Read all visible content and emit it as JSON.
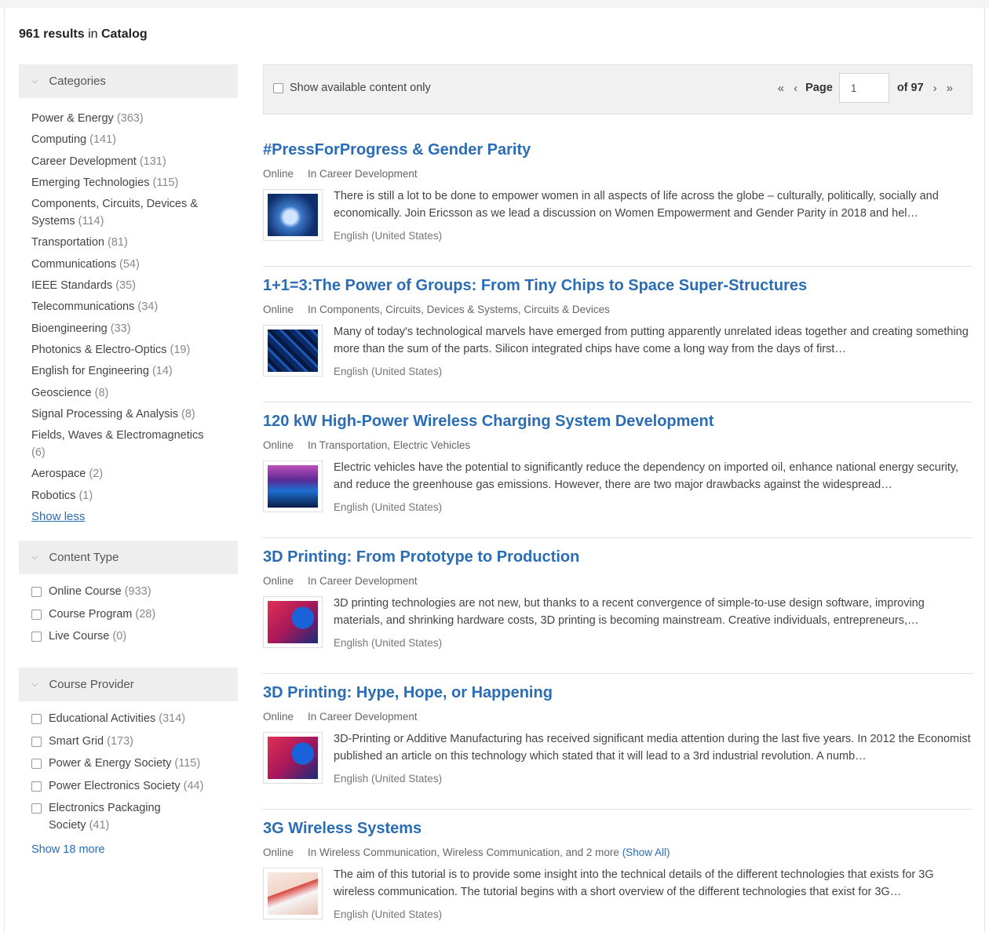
{
  "results_header": {
    "count": "961 results",
    "in_text": "in",
    "scope": "Catalog"
  },
  "facets": {
    "categories": {
      "label": "Categories",
      "items": [
        {
          "name": "Power & Energy",
          "count": "(363)"
        },
        {
          "name": "Computing",
          "count": "(141)"
        },
        {
          "name": "Career Development",
          "count": "(131)"
        },
        {
          "name": "Emerging Technologies",
          "count": "(115)"
        },
        {
          "name": "Components, Circuits, Devices & Systems",
          "count": "(114)"
        },
        {
          "name": "Transportation",
          "count": "(81)"
        },
        {
          "name": "Communications",
          "count": "(54)"
        },
        {
          "name": "IEEE Standards",
          "count": "(35)"
        },
        {
          "name": "Telecommunications",
          "count": "(34)"
        },
        {
          "name": "Bioengineering",
          "count": "(33)"
        },
        {
          "name": "Photonics & Electro-Optics",
          "count": "(19)"
        },
        {
          "name": "English for Engineering",
          "count": "(14)"
        },
        {
          "name": "Geoscience",
          "count": "(8)"
        },
        {
          "name": "Signal Processing & Analysis",
          "count": "(8)"
        },
        {
          "name": "Fields, Waves & Electromagnetics",
          "count": "(6)"
        },
        {
          "name": "Aerospace",
          "count": "(2)"
        },
        {
          "name": "Robotics",
          "count": "(1)"
        }
      ],
      "toggle_label": "Show less"
    },
    "content_type": {
      "label": "Content Type",
      "items": [
        {
          "name": "Online Course",
          "count": "(933)"
        },
        {
          "name": "Course Program",
          "count": "(28)"
        },
        {
          "name": "Live Course",
          "count": "(0)"
        }
      ]
    },
    "course_provider": {
      "label": "Course Provider",
      "items": [
        {
          "name": "Educational Activities",
          "count": "(314)"
        },
        {
          "name": "Smart Grid",
          "count": "(173)"
        },
        {
          "name": "Power & Energy Society",
          "count": "(115)"
        },
        {
          "name": "Power Electronics Society",
          "count": "(44)"
        },
        {
          "name": "Electronics Packaging Society",
          "count": "(41)"
        }
      ],
      "more_label": "Show 18 more"
    }
  },
  "toolbar": {
    "available_only_label": "Show available content only",
    "page_label": "Page",
    "page_value": "1",
    "of_label": "of 97",
    "first_icon": "«",
    "prev_icon": "‹",
    "next_icon": "›",
    "last_icon": "»"
  },
  "results": [
    {
      "title": "#PressForProgress & Gender Parity",
      "format": "Online",
      "category": "In Career Development",
      "description": "There is still a lot to be done to empower women in all aspects of life across the globe – culturally, politically, socially and economically. Join Ericsson as we lead a discussion on Women Empowerment and Gender Parity in 2018 and hel…",
      "language": "English (United States)"
    },
    {
      "title": "1+1=3:The Power of Groups: From Tiny Chips to Space Super-Structures",
      "format": "Online",
      "category": "In Components, Circuits, Devices & Systems, Circuits & Devices",
      "description": "Many of today's technological marvels have emerged from putting apparently unrelated ideas together and creating something more than the sum of the parts. Silicon integrated chips have come a long way from the days of first…",
      "language": "English (United States)"
    },
    {
      "title": "120 kW High-Power Wireless Charging System Development",
      "format": "Online",
      "category": "In Transportation, Electric Vehicles",
      "description": "Electric vehicles have the potential to significantly reduce the dependency on imported oil, enhance national energy security, and reduce the greenhouse gas emissions. However, there are two major drawbacks against the widespread…",
      "language": "English (United States)"
    },
    {
      "title": "3D Printing: From Prototype to Production",
      "format": "Online",
      "category": "In Career Development",
      "description": "3D printing technologies are not new, but thanks to a recent convergence of simple-to-use design software, improving materials, and shrinking hardware costs, 3D printing is becoming mainstream.  Creative individuals, entrepreneurs,…",
      "language": "English (United States)"
    },
    {
      "title": "3D Printing: Hype, Hope, or Happening",
      "format": "Online",
      "category": "In Career Development",
      "description": "3D-Printing or Additive Manufacturing has received significant media attention during the last five years. In 2012 the Economist published an article on this technology which stated that it will lead to a 3rd industrial revolution. A numb…",
      "language": "English (United States)"
    },
    {
      "title": "3G Wireless Systems",
      "format": "Online",
      "category": "In Wireless Communication, Wireless Communication, and 2 more",
      "show_all": "(Show All)",
      "description": "The aim of this tutorial is to provide some insight into the technical  details of the different technologies that exists for 3G wireless  communication. The tutorial begins with a short overview of the  different technologies that exist for 3G…",
      "language": "English (United States)"
    }
  ]
}
